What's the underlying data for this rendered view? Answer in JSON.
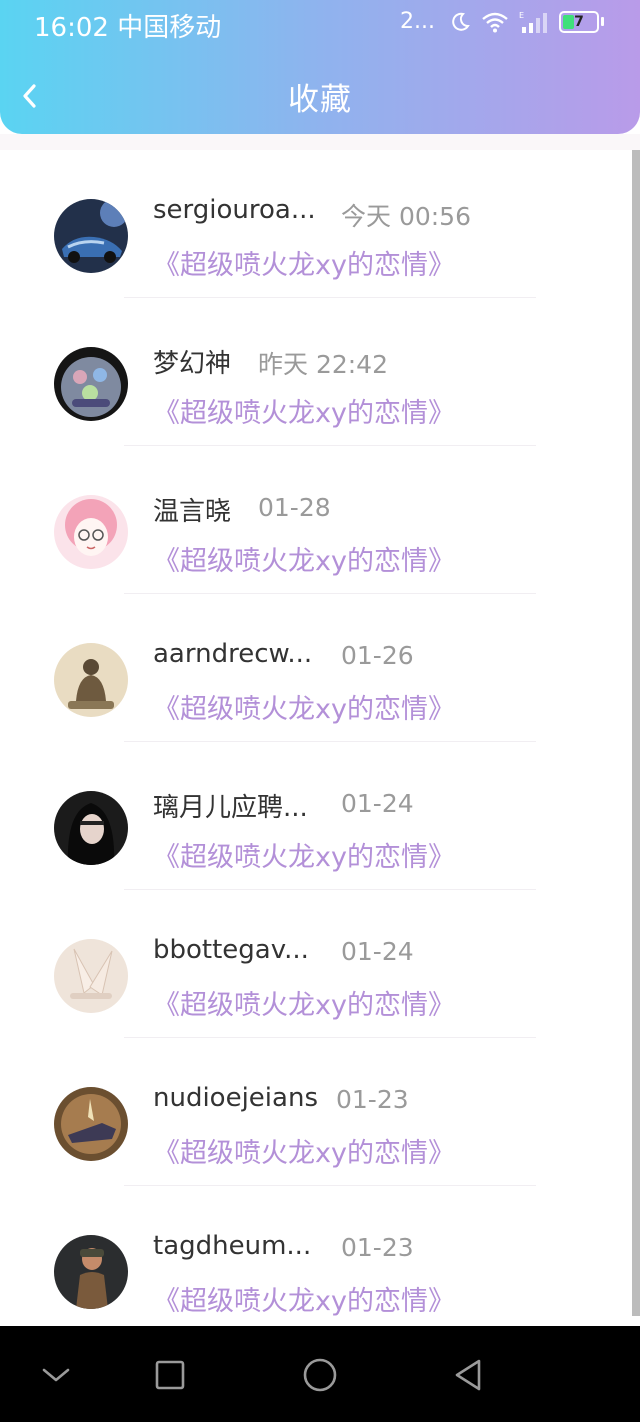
{
  "status_bar": {
    "time": "16:02 中国移动",
    "network": "2...",
    "battery": "7"
  },
  "header": {
    "title": "收藏"
  },
  "items": [
    {
      "user": "sergiouroa...",
      "time": "今天 00:56",
      "title": "《超级喷火龙xy的恋情》"
    },
    {
      "user": "梦幻神",
      "time": "昨天 22:42",
      "title": "《超级喷火龙xy的恋情》"
    },
    {
      "user": "温言晓",
      "time": "01-28",
      "title": "《超级喷火龙xy的恋情》"
    },
    {
      "user": "aarndrecw...",
      "time": "01-26",
      "title": "《超级喷火龙xy的恋情》"
    },
    {
      "user": "璃月儿应聘...",
      "time": "01-24",
      "title": "《超级喷火龙xy的恋情》"
    },
    {
      "user": "bbottegav...",
      "time": "01-24",
      "title": "《超级喷火龙xy的恋情》"
    },
    {
      "user": "nudioejeians",
      "time": "01-23",
      "title": "《超级喷火龙xy的恋情》"
    },
    {
      "user": "tagdheum...",
      "time": "01-23",
      "title": "《超级喷火龙xy的恋情》"
    }
  ],
  "colors": {
    "accent": "#b390d8",
    "header_start": "#5ad4f2",
    "header_end": "#b99be9"
  }
}
